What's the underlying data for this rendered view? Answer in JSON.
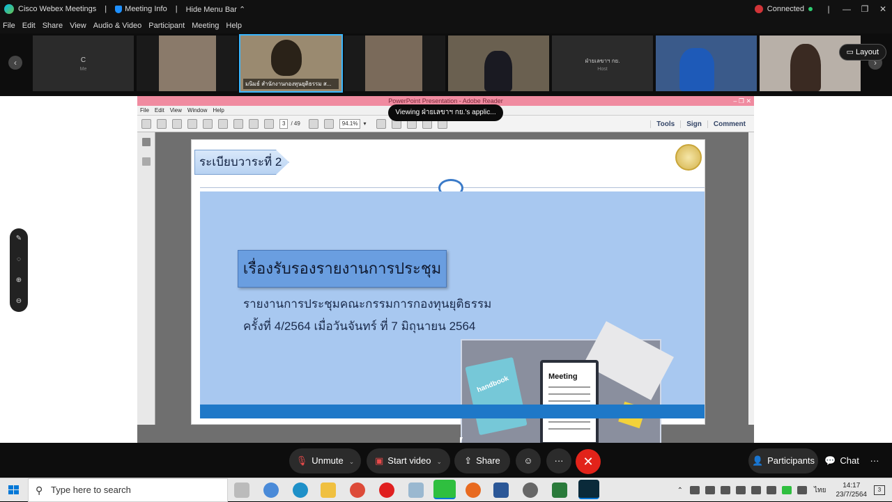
{
  "titlebar": {
    "app_name": "Cisco Webex Meetings",
    "separator": "|",
    "meeting_info": "Meeting Info",
    "hide_menu": "Hide Menu Bar",
    "hide_menu_chevron": "chevron-up-icon",
    "status": "Connected",
    "status_color": "#2ecc71",
    "bar_glyph": "|",
    "minimize": "—",
    "restore": "❐",
    "close": "✕"
  },
  "menubar": [
    "File",
    "Edit",
    "Share",
    "View",
    "Audio & Video",
    "Participant",
    "Meeting",
    "Help"
  ],
  "participants": [
    {
      "name": "C",
      "sub": "Me",
      "video": false
    },
    {
      "name": "",
      "video": true,
      "tone": "#8a7a6a"
    },
    {
      "name": "มนิมธ์ สำนักงานกองทุนยุติธรรม ส...",
      "video": true,
      "active": true,
      "tone": "#9a8a70"
    },
    {
      "name": "",
      "video": true,
      "tone": "#7a6a5a"
    },
    {
      "name": "",
      "video": true,
      "tone": "#6a6050"
    },
    {
      "name": "ฝ่ายเลขาฯ กย.",
      "sub": "Host",
      "video": false
    },
    {
      "name": "",
      "video": true,
      "tone": "#3a5a8a"
    },
    {
      "name": "",
      "video": true,
      "tone": "#b8b0a8"
    }
  ],
  "layout_label": "Layout",
  "nav": {
    "prev": "‹",
    "next": "›"
  },
  "viewing_banner": "Viewing ฝ่ายเลขาฯ กย.'s applic...",
  "reader": {
    "title": "PowerPoint Presentation - Adobe Reader",
    "menu": [
      "File",
      "Edit",
      "View",
      "Window",
      "Help"
    ],
    "page_current": "3",
    "page_total": "/ 49",
    "zoom": "94.1%",
    "tools": "Tools",
    "sign": "Sign",
    "comment": "Comment"
  },
  "slide": {
    "agenda": "ระเบียบวาระที่ 2",
    "subject": "เรื่องรับรองรายงานการประชุม",
    "line1": "รายงานการประชุมคณะกรรมการกองทุนยุติธรรม",
    "line2": "ครั้งที่ 4/2564 เมื่อวันจันทร์ ที่ 7 มิถุนายน 2564",
    "book_label": "handbook",
    "clip_label": "Meeting"
  },
  "side_tools": [
    "pen-icon",
    "lasso-icon",
    "zoom-in-icon",
    "zoom-out-icon"
  ],
  "controls": {
    "unmute": "Unmute",
    "start_video": "Start video",
    "share": "Share",
    "more": "···",
    "end": "✕",
    "participants": "Participants",
    "chat": "Chat",
    "more_right": "···"
  },
  "taskbar": {
    "search_placeholder": "Type here to search",
    "time": "14:17",
    "date": "23/7/2564",
    "lang": "ไทย",
    "notifications": "3"
  }
}
